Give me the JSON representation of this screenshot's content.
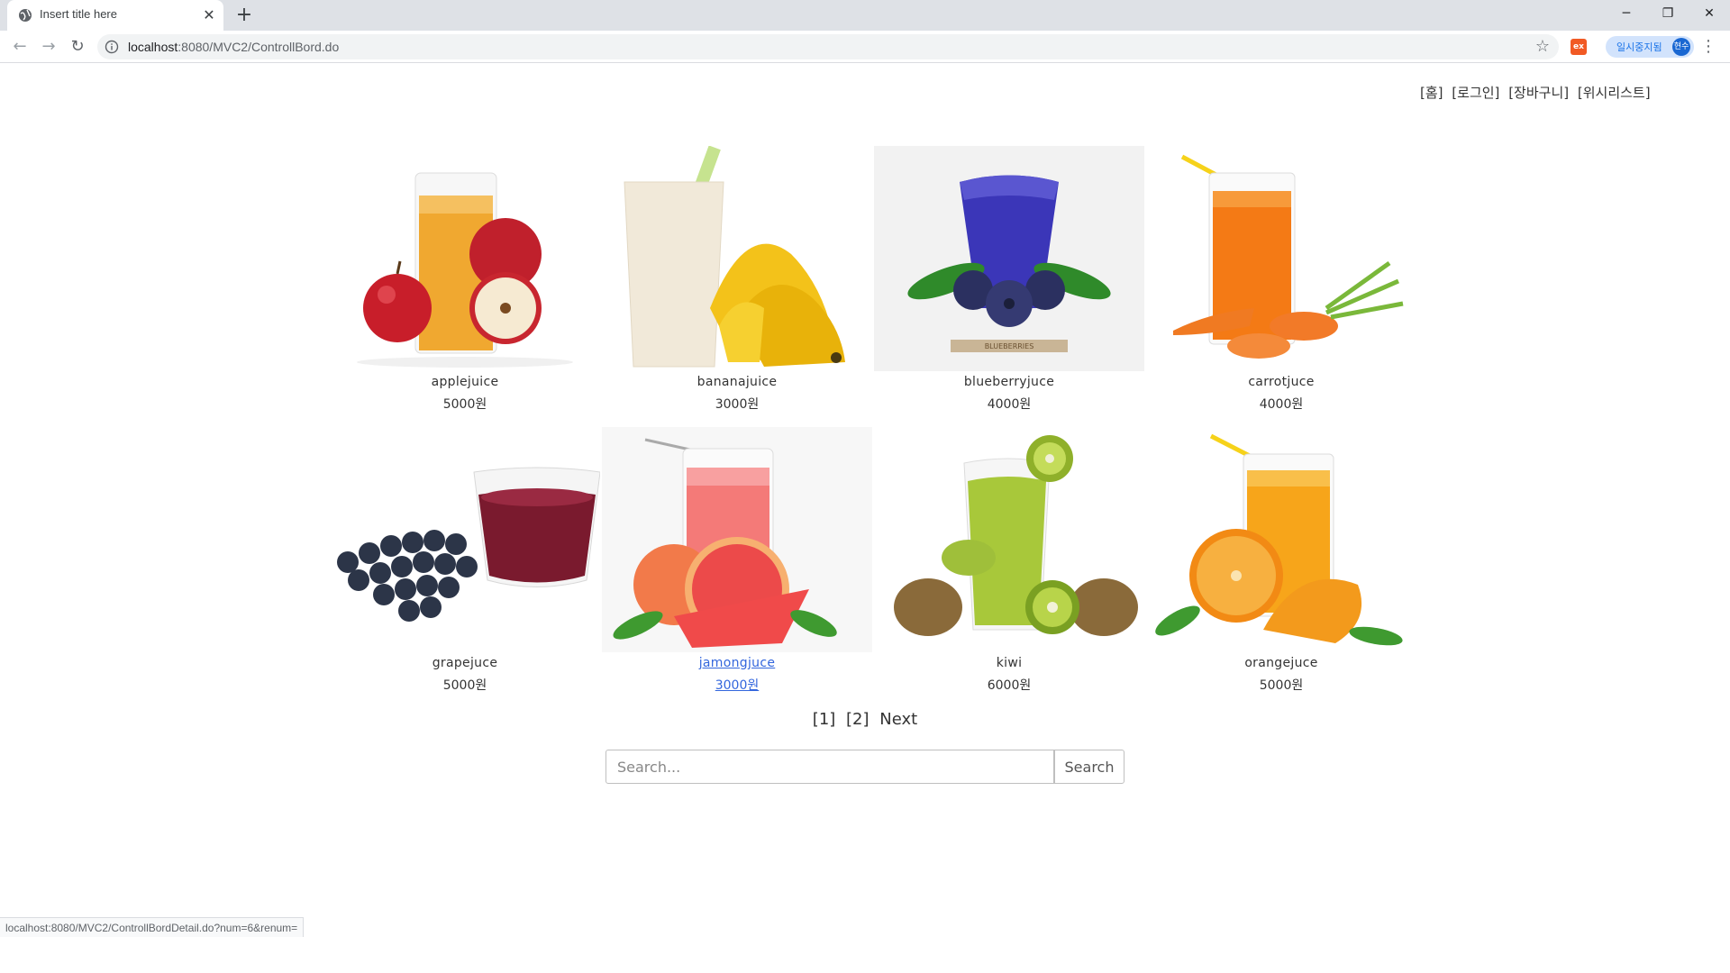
{
  "browser": {
    "tab_title": "Insert title here",
    "url_host": "localhost",
    "url_rest": ":8080/MVC2/ControllBord.do",
    "profile_label": "일시중지됨",
    "profile_initials": "현수",
    "extension_label": "ex"
  },
  "header": {
    "links": [
      "[홈]",
      "[로그인]",
      "[장바구니]",
      "[위시리스트]"
    ]
  },
  "products": [
    {
      "name": "applejuice",
      "price": "5000원",
      "image": "apple-juice-image"
    },
    {
      "name": "bananajuice",
      "price": "3000원",
      "image": "banana-juice-image"
    },
    {
      "name": "blueberryjuce",
      "price": "4000원",
      "image": "blueberry-juice-image",
      "image_caption": "BLUEBERRIES"
    },
    {
      "name": "carrotjuce",
      "price": "4000원",
      "image": "carrot-juice-image"
    },
    {
      "name": "grapejuce",
      "price": "5000원",
      "image": "grape-juice-image"
    },
    {
      "name": "jamongjuce",
      "price": "3000원",
      "image": "grapefruit-juice-image",
      "hovered": true
    },
    {
      "name": "kiwi",
      "price": "6000원",
      "image": "kiwi-juice-image"
    },
    {
      "name": "orangejuce",
      "price": "5000원",
      "image": "orange-juice-image"
    }
  ],
  "pager": {
    "pages": [
      "[1]",
      "[2]"
    ],
    "next_label": "Next"
  },
  "search": {
    "placeholder": "Search...",
    "value": "",
    "button_label": "Search"
  },
  "status_bar": {
    "text": "localhost:8080/MVC2/ControllBordDetail.do?num=6&renum="
  }
}
